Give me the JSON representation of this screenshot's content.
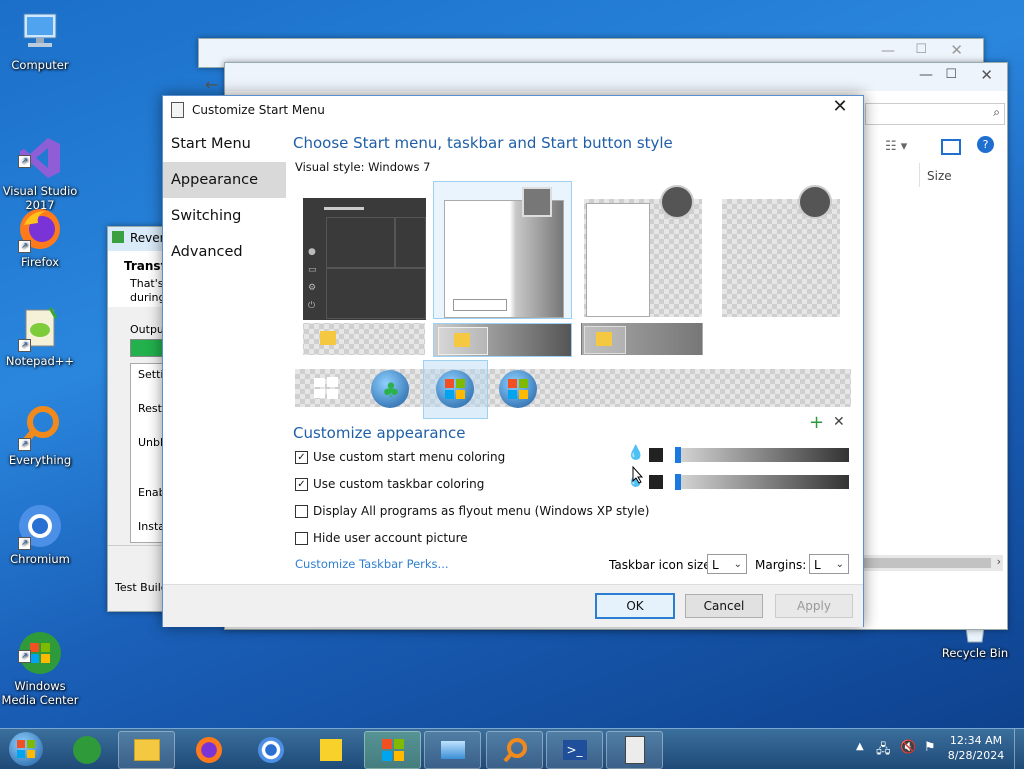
{
  "desktop": {
    "icons": [
      {
        "label": "Computer",
        "icon": "computer-icon"
      },
      {
        "label": "Visual Studio\n2017",
        "icon": "visual-studio-icon"
      },
      {
        "label": "Firefox",
        "icon": "firefox-icon"
      },
      {
        "label": "Notepad++",
        "icon": "notepadpp-icon"
      },
      {
        "label": "Everything",
        "icon": "everything-icon"
      },
      {
        "label": "Chromium",
        "icon": "chromium-icon"
      },
      {
        "label": "Windows\nMedia Center",
        "icon": "media-center-icon"
      }
    ],
    "recycle_bin": "Recycle Bin"
  },
  "bg_window_left": {
    "title": "Rever",
    "heading": "Transfo",
    "line1": "That's",
    "line2": "during",
    "output_label": "Outpu",
    "list": [
      "Settin",
      "Resto",
      "Unblo",
      "Enab",
      "Insta"
    ],
    "status": "Test Build"
  },
  "bg_window_right": {
    "column_size": "Size"
  },
  "dialog": {
    "title": "Customize Start Menu",
    "nav": [
      "Start Menu",
      "Appearance",
      "Switching",
      "Advanced"
    ],
    "selected_nav": "Appearance",
    "heading": "Choose Start menu, taskbar and Start button style",
    "visual_style_label": "Visual style:",
    "visual_style_value": "Windows 7",
    "appearance_heading": "Customize appearance",
    "options": [
      {
        "label": "Use custom start menu coloring",
        "checked": true
      },
      {
        "label": "Use custom taskbar coloring",
        "checked": true
      },
      {
        "label": "Display All programs as flyout menu (Windows XP style)",
        "checked": false
      },
      {
        "label": "Hide user account picture",
        "checked": false
      }
    ],
    "link": "Customize Taskbar Perks...",
    "icon_size_label": "Taskbar icon size:",
    "icon_size_value": "L",
    "margins_label": "Margins:",
    "margins_value": "L",
    "buttons": {
      "ok": "OK",
      "cancel": "Cancel",
      "apply": "Apply"
    },
    "colors": {
      "accent": "#1f5fa8",
      "link": "#2f7fd0"
    }
  },
  "taskbar": {
    "time": "12:34 AM",
    "date": "8/28/2024"
  }
}
